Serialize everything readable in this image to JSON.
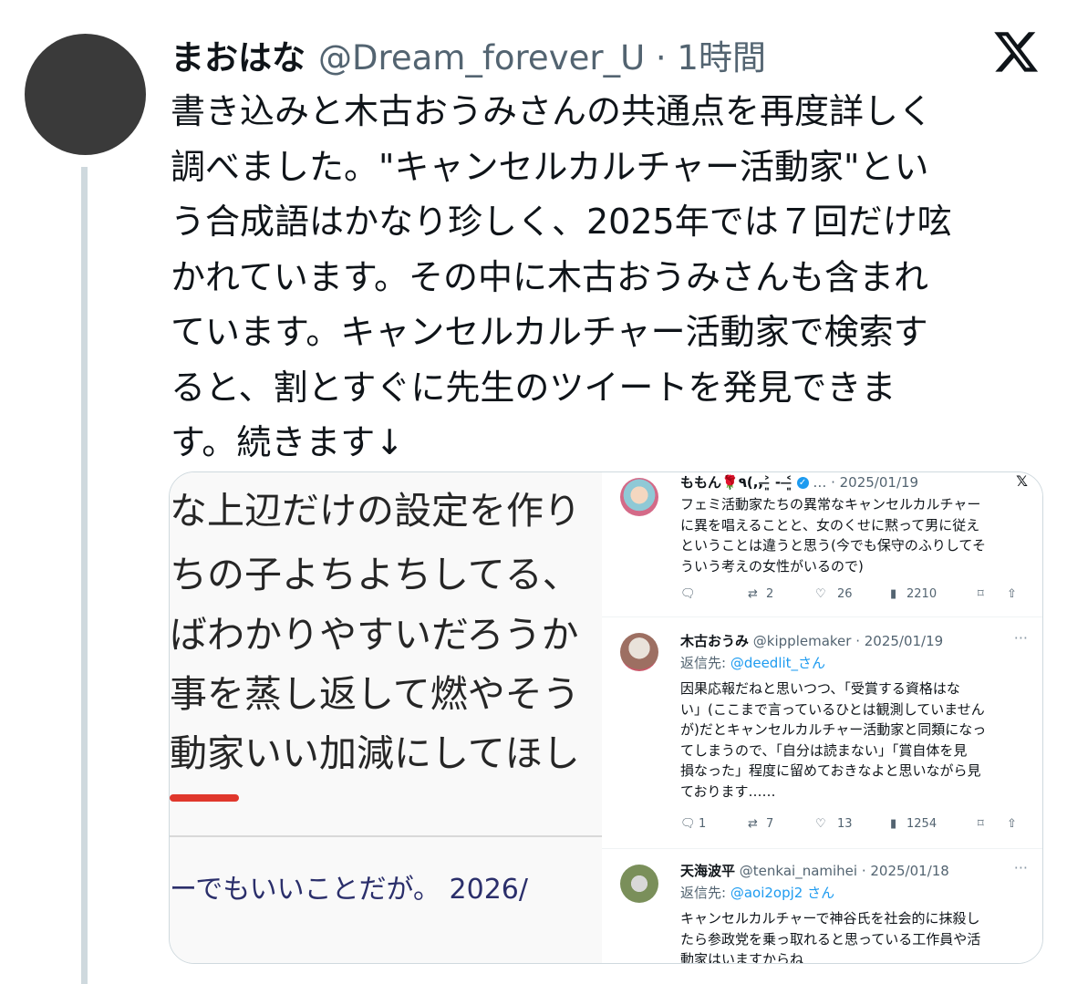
{
  "tweet": {
    "author_name": "まおはな",
    "handle_time": "@Dream_forever_U · 1時間",
    "text_lines": [
      "書き込みと木古おうみさんの共通点を再度詳しく",
      "調べました。\"キャンセルカルチャー活動家\"とい",
      "う合成語はかなり珍しく、2025年では７回だけ呟",
      "かれています。その中に木古おうみさんも含まれ",
      "ています。キャンセルカルチャー活動家で検索す",
      "ると、割とすぐに先生のツイートを発見できま",
      "す。続きます↓"
    ]
  },
  "media_left": {
    "lines": [
      "な上辺だけの設定を作り",
      "ちの子よちよちしてる、",
      "ばわかりやすいだろうか",
      "事を蒸し返して燃やそう",
      "動家いい加減にしてほし"
    ],
    "footer": "ーでもいいことだが。 2026/"
  },
  "media_right": {
    "posts": [
      {
        "name": "ももん🌹٩(,,˃̶͈ - ˂̶͈",
        "meta": "… · 2025/01/19",
        "body": [
          "フェミ活動家たちの異常なキャンセルカルチャー",
          "に異を唱えることと、女のくせに黙って男に従え",
          "ということは違うと思う(今でも保守のふりしてそ",
          "ういう考えの女性がいるので)"
        ],
        "reposts": "2",
        "likes": "26",
        "views": "2210"
      },
      {
        "name": "木古おうみ",
        "meta": "@kipplemaker · 2025/01/19",
        "reply_prefix": "返信先: ",
        "reply_to": "@deedlit_さん",
        "body": [
          "因果応報だねと思いつつ、「受賞する資格はな",
          "い」(ここまで言っているひとは観測していません",
          "が)だとキャンセルカルチャー活動家と同類になっ",
          "てしまうので、「自分は読まない」「賞自体を見",
          "損なった」程度に留めておきなよと思いながら見",
          "ております……"
        ],
        "replies": "1",
        "reposts": "7",
        "likes": "13",
        "views": "1254"
      },
      {
        "name": "天海波平",
        "meta": "@tenkai_namihei · 2025/01/18",
        "reply_prefix": "返信先: ",
        "reply_to": "@aoi2opj2 さん",
        "body": [
          "キャンセルカルチャーで神谷氏を社会的に抹殺し",
          "たら参政党を乗っ取れると思っている工作員や活",
          "動家はいますからね"
        ]
      }
    ]
  },
  "colors": {
    "text": "#0f1419",
    "secondary": "#536471",
    "link": "#1d9bf0",
    "thread_line": "#cfd9de",
    "avatar": "#3a3a3a",
    "red_bar": "#e0372c"
  },
  "icons": [
    "x-logo-icon",
    "reply-icon",
    "repost-icon",
    "like-icon",
    "views-icon",
    "bookmark-icon",
    "share-icon",
    "more-icon",
    "verified-icon"
  ]
}
